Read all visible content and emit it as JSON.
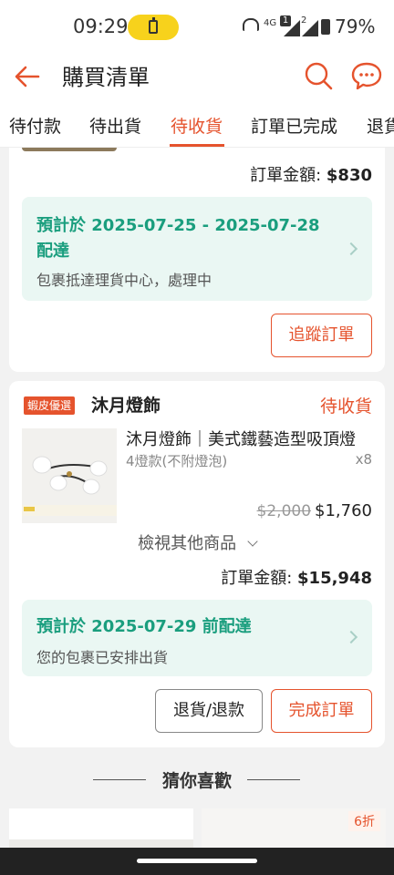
{
  "status_bar": {
    "time": "09:29",
    "net_label": "4G",
    "sim1": "1",
    "sim2": "2",
    "battery": "79%"
  },
  "header": {
    "title": "購買清單"
  },
  "tabs": [
    {
      "label": "待付款"
    },
    {
      "label": "待出貨"
    },
    {
      "label": "待收貨"
    },
    {
      "label": "訂單已完成"
    },
    {
      "label": "退貨"
    }
  ],
  "order1": {
    "total_label": "訂單金額: ",
    "total_value": "$830",
    "delivery_title": "預計於 2025-07-25 - 2025-07-28 配達",
    "delivery_sub": "包裹抵達理貨中心，處理中",
    "track_button": "追蹤訂單"
  },
  "order2": {
    "badge": "蝦皮優選",
    "shop_name": "沐月燈飾",
    "status": "待收貨",
    "product_title": "沐月燈飾｜美式鐵藝造型吸頂燈",
    "product_variant": "4燈款(不附燈泡)",
    "product_qty": "x8",
    "price_original": "$2,000",
    "price_now": "$1,760",
    "view_more": "檢視其他商品",
    "total_label": "訂單金額: ",
    "total_value": "$15,948",
    "delivery_title": "預計於 2025-07-29 前配達",
    "delivery_sub": "您的包裹已安排出貨",
    "return_button": "退貨/退款",
    "complete_button": "完成訂單"
  },
  "recommend": {
    "title": "猜你喜歡",
    "discount": "6折"
  },
  "colors": {
    "accent": "#e5532d",
    "teal": "#1a9e7e",
    "teal_bg": "#eaf7f3",
    "battery_pill": "#f7d21c"
  }
}
